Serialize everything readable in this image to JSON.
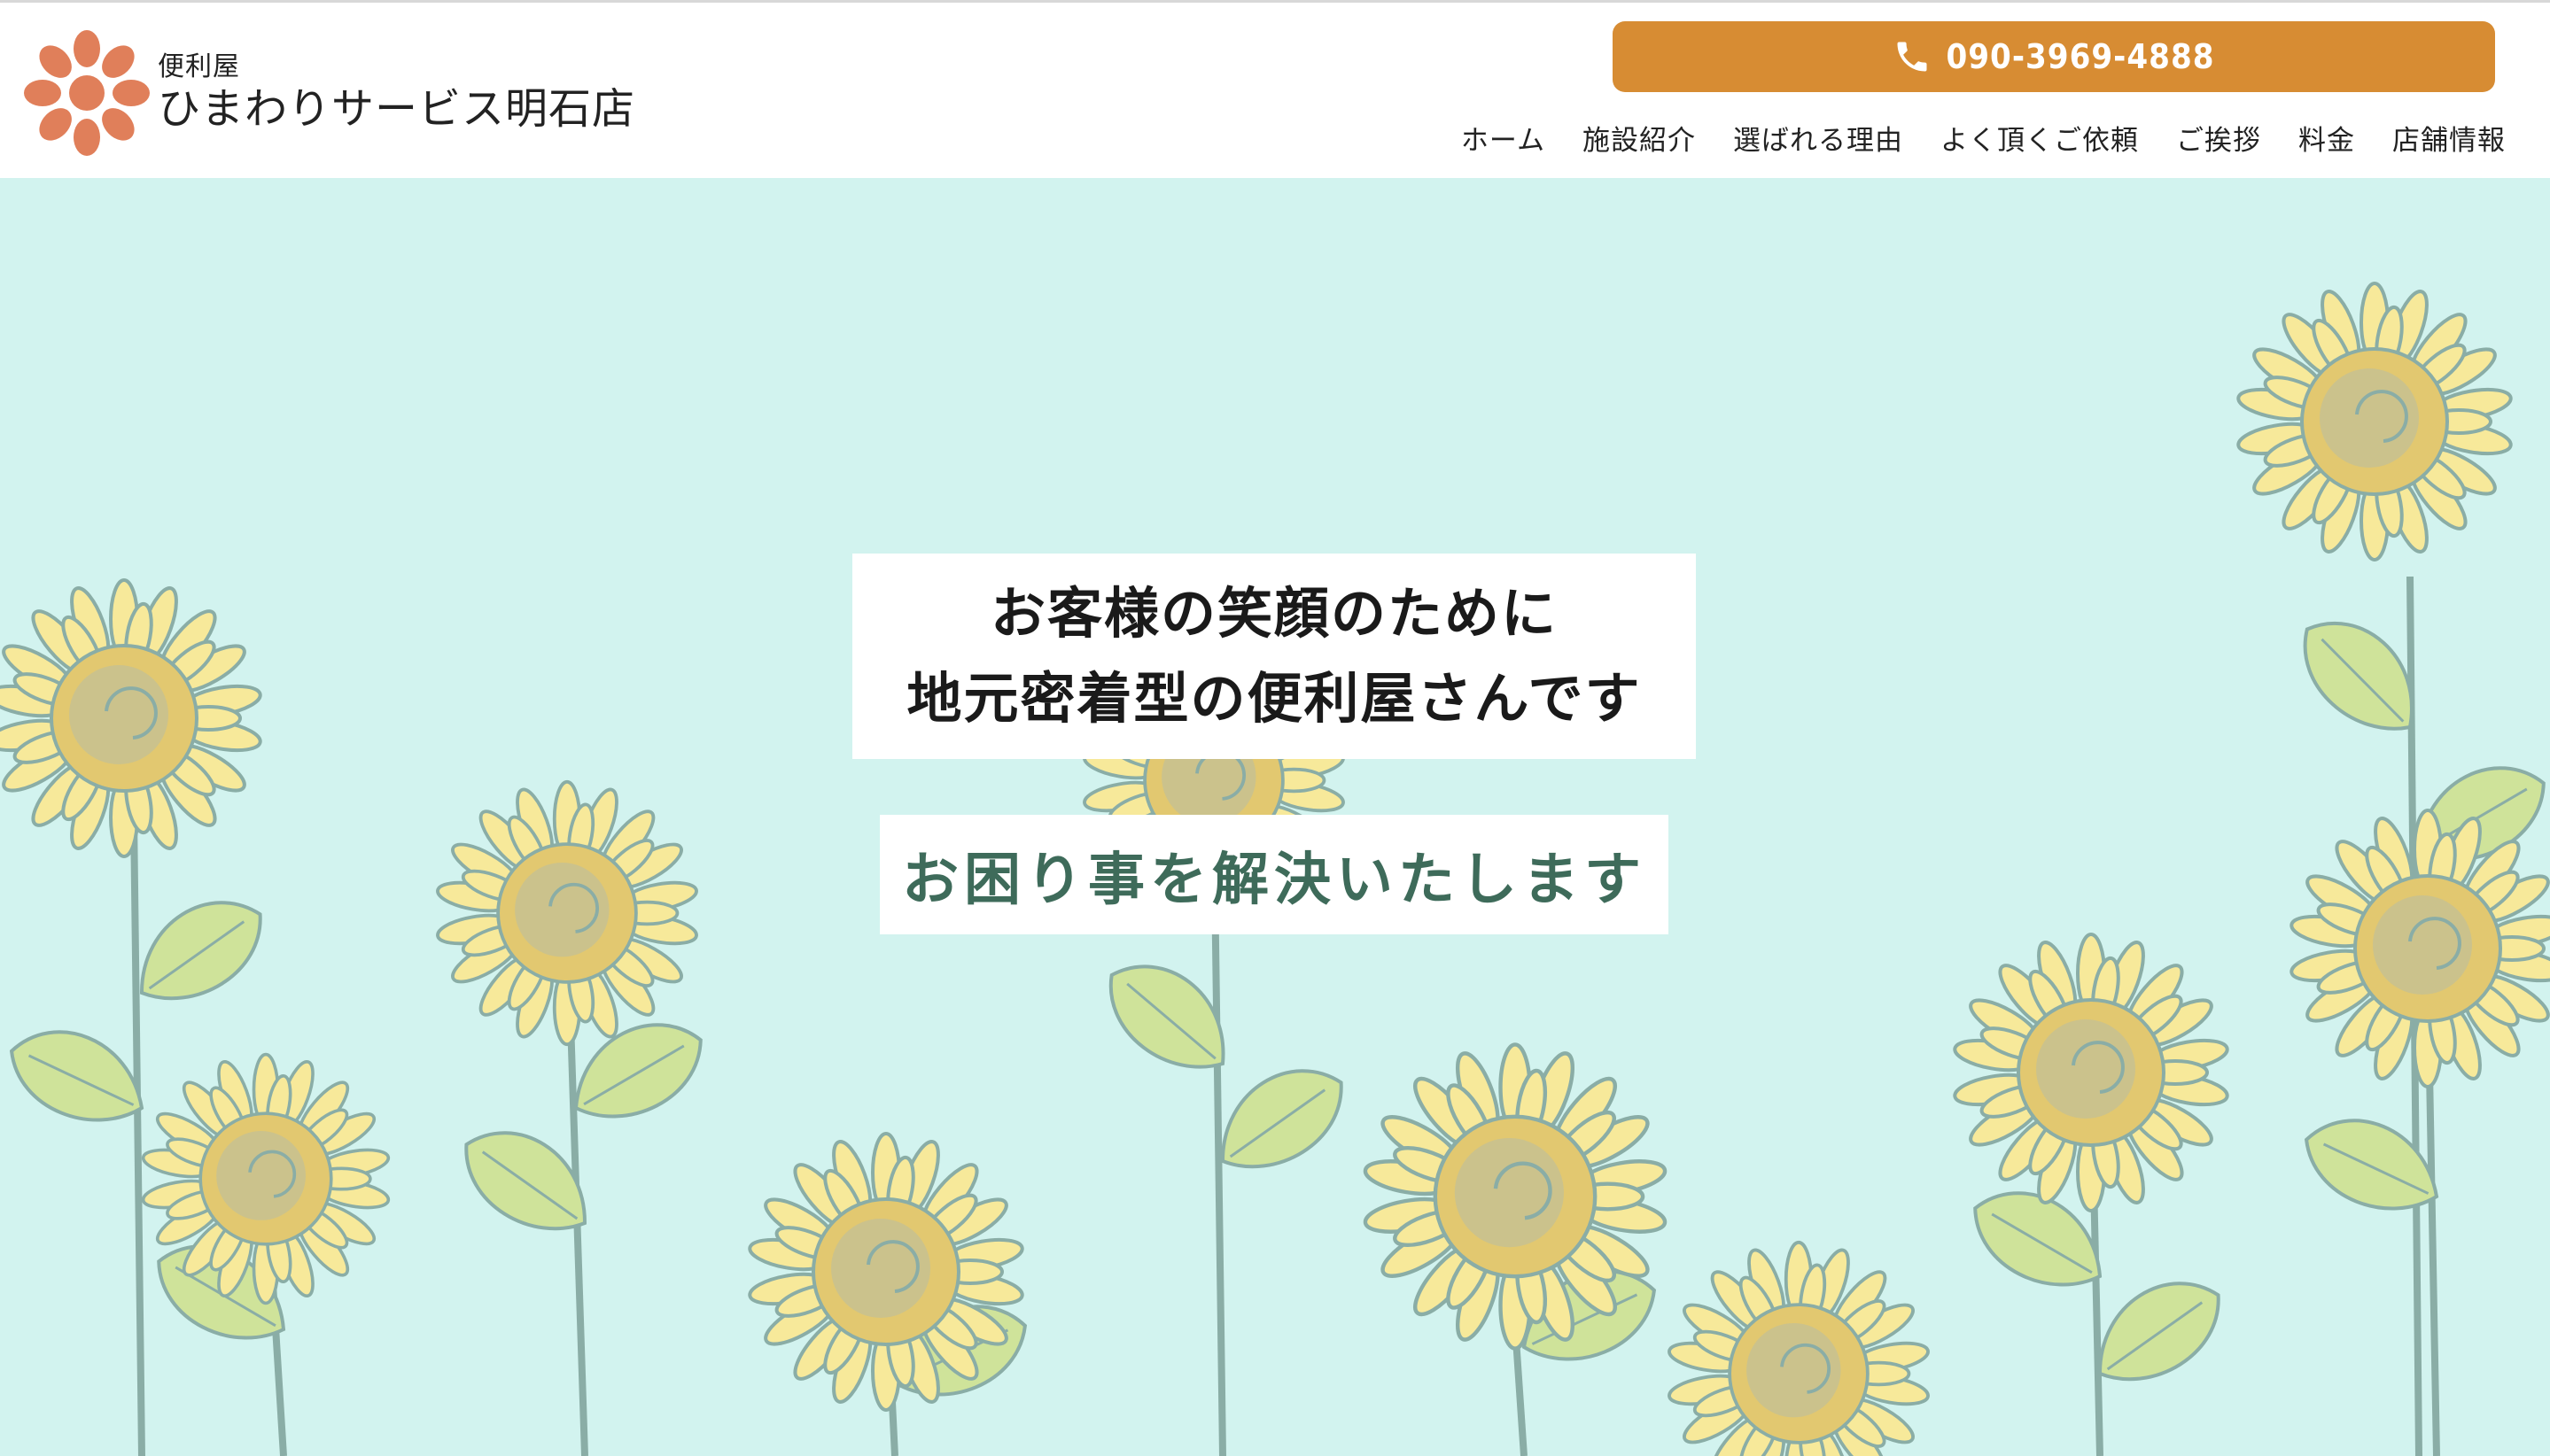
{
  "header": {
    "brand_sub": "便利屋",
    "brand_name": "ひまわりサービス明石店",
    "phone": "090-3969-4888"
  },
  "nav": [
    "ホーム",
    "施設紹介",
    "選ばれる理由",
    "よく頂くご依頼",
    "ご挨拶",
    "料金",
    "店舗情報"
  ],
  "hero": {
    "headline_1": "お客様の笑顔のために",
    "headline_2": "地元密着型の便利屋さんです",
    "sub": "お困り事を解決いたします"
  },
  "colors": {
    "accent": "#d78c33",
    "logo": "#e07f5a",
    "hero_bg": "#d2f3ef",
    "sub_text": "#3e6b5a"
  },
  "icons": {
    "logo": "sunflower-logo-icon",
    "phone": "phone-icon"
  }
}
